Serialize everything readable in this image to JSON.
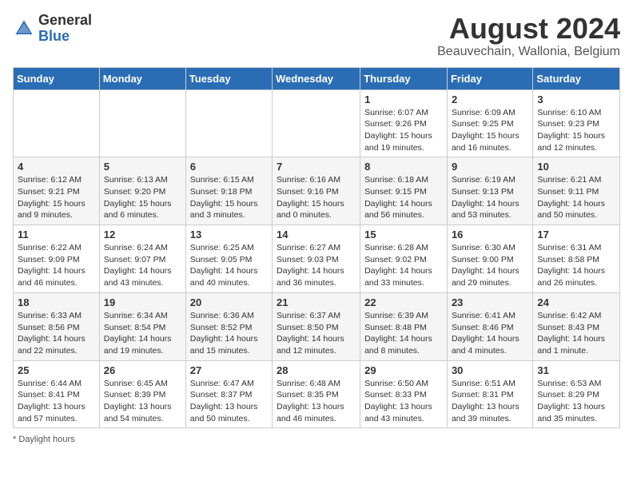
{
  "header": {
    "logo_general": "General",
    "logo_blue": "Blue",
    "main_title": "August 2024",
    "subtitle": "Beauvechain, Wallonia, Belgium"
  },
  "days_of_week": [
    "Sunday",
    "Monday",
    "Tuesday",
    "Wednesday",
    "Thursday",
    "Friday",
    "Saturday"
  ],
  "footer": {
    "note": "Daylight hours"
  },
  "weeks": [
    [
      {
        "day": "",
        "info": ""
      },
      {
        "day": "",
        "info": ""
      },
      {
        "day": "",
        "info": ""
      },
      {
        "day": "",
        "info": ""
      },
      {
        "day": "1",
        "info": "Sunrise: 6:07 AM\nSunset: 9:26 PM\nDaylight: 15 hours\nand 19 minutes."
      },
      {
        "day": "2",
        "info": "Sunrise: 6:09 AM\nSunset: 9:25 PM\nDaylight: 15 hours\nand 16 minutes."
      },
      {
        "day": "3",
        "info": "Sunrise: 6:10 AM\nSunset: 9:23 PM\nDaylight: 15 hours\nand 12 minutes."
      }
    ],
    [
      {
        "day": "4",
        "info": "Sunrise: 6:12 AM\nSunset: 9:21 PM\nDaylight: 15 hours\nand 9 minutes."
      },
      {
        "day": "5",
        "info": "Sunrise: 6:13 AM\nSunset: 9:20 PM\nDaylight: 15 hours\nand 6 minutes."
      },
      {
        "day": "6",
        "info": "Sunrise: 6:15 AM\nSunset: 9:18 PM\nDaylight: 15 hours\nand 3 minutes."
      },
      {
        "day": "7",
        "info": "Sunrise: 6:16 AM\nSunset: 9:16 PM\nDaylight: 15 hours\nand 0 minutes."
      },
      {
        "day": "8",
        "info": "Sunrise: 6:18 AM\nSunset: 9:15 PM\nDaylight: 14 hours\nand 56 minutes."
      },
      {
        "day": "9",
        "info": "Sunrise: 6:19 AM\nSunset: 9:13 PM\nDaylight: 14 hours\nand 53 minutes."
      },
      {
        "day": "10",
        "info": "Sunrise: 6:21 AM\nSunset: 9:11 PM\nDaylight: 14 hours\nand 50 minutes."
      }
    ],
    [
      {
        "day": "11",
        "info": "Sunrise: 6:22 AM\nSunset: 9:09 PM\nDaylight: 14 hours\nand 46 minutes."
      },
      {
        "day": "12",
        "info": "Sunrise: 6:24 AM\nSunset: 9:07 PM\nDaylight: 14 hours\nand 43 minutes."
      },
      {
        "day": "13",
        "info": "Sunrise: 6:25 AM\nSunset: 9:05 PM\nDaylight: 14 hours\nand 40 minutes."
      },
      {
        "day": "14",
        "info": "Sunrise: 6:27 AM\nSunset: 9:03 PM\nDaylight: 14 hours\nand 36 minutes."
      },
      {
        "day": "15",
        "info": "Sunrise: 6:28 AM\nSunset: 9:02 PM\nDaylight: 14 hours\nand 33 minutes."
      },
      {
        "day": "16",
        "info": "Sunrise: 6:30 AM\nSunset: 9:00 PM\nDaylight: 14 hours\nand 29 minutes."
      },
      {
        "day": "17",
        "info": "Sunrise: 6:31 AM\nSunset: 8:58 PM\nDaylight: 14 hours\nand 26 minutes."
      }
    ],
    [
      {
        "day": "18",
        "info": "Sunrise: 6:33 AM\nSunset: 8:56 PM\nDaylight: 14 hours\nand 22 minutes."
      },
      {
        "day": "19",
        "info": "Sunrise: 6:34 AM\nSunset: 8:54 PM\nDaylight: 14 hours\nand 19 minutes."
      },
      {
        "day": "20",
        "info": "Sunrise: 6:36 AM\nSunset: 8:52 PM\nDaylight: 14 hours\nand 15 minutes."
      },
      {
        "day": "21",
        "info": "Sunrise: 6:37 AM\nSunset: 8:50 PM\nDaylight: 14 hours\nand 12 minutes."
      },
      {
        "day": "22",
        "info": "Sunrise: 6:39 AM\nSunset: 8:48 PM\nDaylight: 14 hours\nand 8 minutes."
      },
      {
        "day": "23",
        "info": "Sunrise: 6:41 AM\nSunset: 8:46 PM\nDaylight: 14 hours\nand 4 minutes."
      },
      {
        "day": "24",
        "info": "Sunrise: 6:42 AM\nSunset: 8:43 PM\nDaylight: 14 hours\nand 1 minute."
      }
    ],
    [
      {
        "day": "25",
        "info": "Sunrise: 6:44 AM\nSunset: 8:41 PM\nDaylight: 13 hours\nand 57 minutes."
      },
      {
        "day": "26",
        "info": "Sunrise: 6:45 AM\nSunset: 8:39 PM\nDaylight: 13 hours\nand 54 minutes."
      },
      {
        "day": "27",
        "info": "Sunrise: 6:47 AM\nSunset: 8:37 PM\nDaylight: 13 hours\nand 50 minutes."
      },
      {
        "day": "28",
        "info": "Sunrise: 6:48 AM\nSunset: 8:35 PM\nDaylight: 13 hours\nand 46 minutes."
      },
      {
        "day": "29",
        "info": "Sunrise: 6:50 AM\nSunset: 8:33 PM\nDaylight: 13 hours\nand 43 minutes."
      },
      {
        "day": "30",
        "info": "Sunrise: 6:51 AM\nSunset: 8:31 PM\nDaylight: 13 hours\nand 39 minutes."
      },
      {
        "day": "31",
        "info": "Sunrise: 6:53 AM\nSunset: 8:29 PM\nDaylight: 13 hours\nand 35 minutes."
      }
    ]
  ]
}
